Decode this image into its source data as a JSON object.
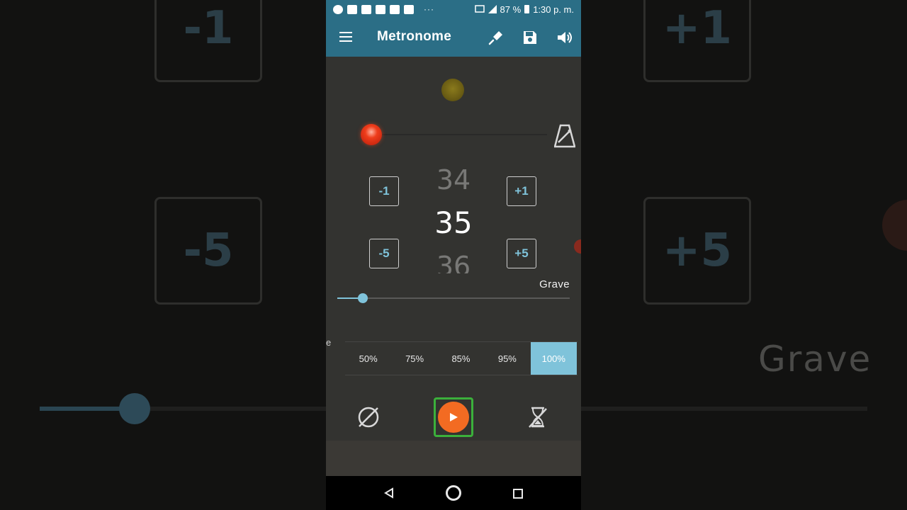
{
  "status_bar": {
    "battery": "87 %",
    "time": "1:30 p. m.",
    "dots": "···"
  },
  "app": {
    "title": "Metronome",
    "icons": [
      "menu-icon",
      "tuning-fork-icon",
      "save-icon",
      "volume-icon"
    ]
  },
  "tempo": {
    "prev": "34",
    "current": "35",
    "next": "36",
    "name": "Grave",
    "slider_fraction": 0.11
  },
  "steppers": {
    "minus_one": "-1",
    "plus_one": "+1",
    "minus_five": "-5",
    "plus_five": "+5"
  },
  "percentages": {
    "cut_label": "e",
    "items": [
      "50%",
      "75%",
      "85%",
      "95%",
      "100%"
    ],
    "active_index": 4
  },
  "background": {
    "minus_one": "-1",
    "plus_one": "+1",
    "minus_five": "-5",
    "plus_five": "+5",
    "tempo_name": "Grave"
  },
  "colors": {
    "app_bar": "#2b6e86",
    "accent": "#7fc3da",
    "play": "#f36b22",
    "play_frame": "#3bb03b",
    "pendulum": "#ef3d1b"
  }
}
